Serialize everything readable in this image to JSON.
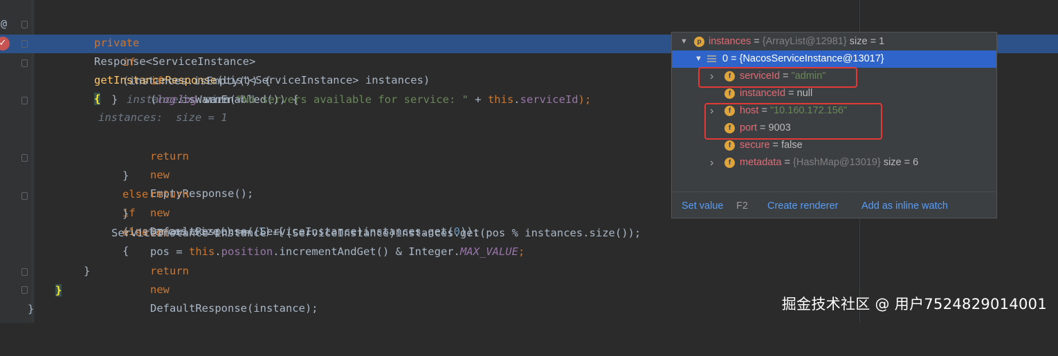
{
  "gutter": {
    "at_symbol": "@"
  },
  "code": {
    "l1": {
      "kw": "private",
      "type": "Response<ServiceInstance>",
      "fn": "getInstanceResponse",
      "params": "(List<ServiceInstance> instances)",
      "brace": "{",
      "hint": "instances:  size = 1"
    },
    "l2": {
      "kw": "if",
      "text": "(instances.isEmpty()) {",
      "hint": "instances:  size = 1"
    },
    "l3": {
      "kw": "if",
      "open": "(",
      "log": "log",
      "rest": ".isWarnEnabled()) {"
    },
    "l4": {
      "log": "log",
      "call": ".warn(",
      "str": "\"No servers available for service: \"",
      "plus": " + ",
      "this_kw": "this",
      "dot": ".",
      "field": "serviceId",
      "end": ");"
    },
    "l5": {
      "text": "}"
    },
    "l6": {
      "kw1": "return",
      "kw2": "new",
      "rest": "EmptyResponse();"
    },
    "l7": {
      "close": "}",
      "kw1": "else",
      "kw2": "if",
      "text": "(instances.size() == ",
      "num": "1",
      "end": ") {"
    },
    "l8": {
      "kw1": "return",
      "kw2": "new",
      "text": "DefaultResponse((ServiceInstance)instances.get(",
      "num": "0",
      "end": "));"
    },
    "l9": {
      "close": "}",
      "kw": "else",
      "end": "{"
    },
    "l10": {
      "kw": "int",
      "text1": "pos = ",
      "this_kw": "this",
      "dot": ".",
      "field": "position",
      "text2": ".incrementAndGet() & Integer.",
      "const": "MAX_VALUE",
      "end": ";"
    },
    "l11": {
      "text": "ServiceInstance instance = (ServiceInstance)instances.get(pos % instances.size());"
    },
    "l12": {
      "kw1": "return",
      "kw2": "new",
      "text": "DefaultResponse(instance);"
    },
    "l13": {
      "text": "}"
    },
    "l14": {
      "text": "}"
    },
    "l15": {
      "text": "}"
    }
  },
  "debug_popup": {
    "root": {
      "icon": "p",
      "name": "instances",
      "eq": " = ",
      "ref": "{ArrayList@12981}",
      "extra": " size = 1"
    },
    "item0": {
      "name": "0",
      "eq": " = ",
      "ref": "{NacosServiceInstance@13017}"
    },
    "fields": [
      {
        "icon": "f",
        "name": "serviceId",
        "eq": " = ",
        "value": "\"admin\"",
        "kind": "string",
        "expandable": true
      },
      {
        "icon": "f",
        "name": "instanceId",
        "eq": " = ",
        "value": "null",
        "kind": "plain",
        "expandable": false
      },
      {
        "icon": "f",
        "name": "host",
        "eq": " = ",
        "value": "\"10.160.172.156\"",
        "kind": "string",
        "expandable": true
      },
      {
        "icon": "f",
        "name": "port",
        "eq": " = ",
        "value": "9003",
        "kind": "plain",
        "expandable": false
      },
      {
        "icon": "f",
        "name": "secure",
        "eq": " = ",
        "value": "false",
        "kind": "plain",
        "expandable": false
      },
      {
        "icon": "f",
        "name": "metadata",
        "eq": " = ",
        "value": "{HashMap@13019}",
        "extra": " size = 6",
        "kind": "ref",
        "expandable": true
      }
    ],
    "footer": {
      "set_value": "Set value",
      "set_value_key": "F2",
      "create_renderer": "Create renderer",
      "add_inline_watch": "Add as inline watch"
    }
  },
  "watermark": "掘金技术社区 @ 用户7524829014001",
  "colors": {
    "editor_bg": "#2b2b2b",
    "selection": "#2d5189",
    "popup_bg": "#3c3f41",
    "highlight_box": "#e53935"
  }
}
